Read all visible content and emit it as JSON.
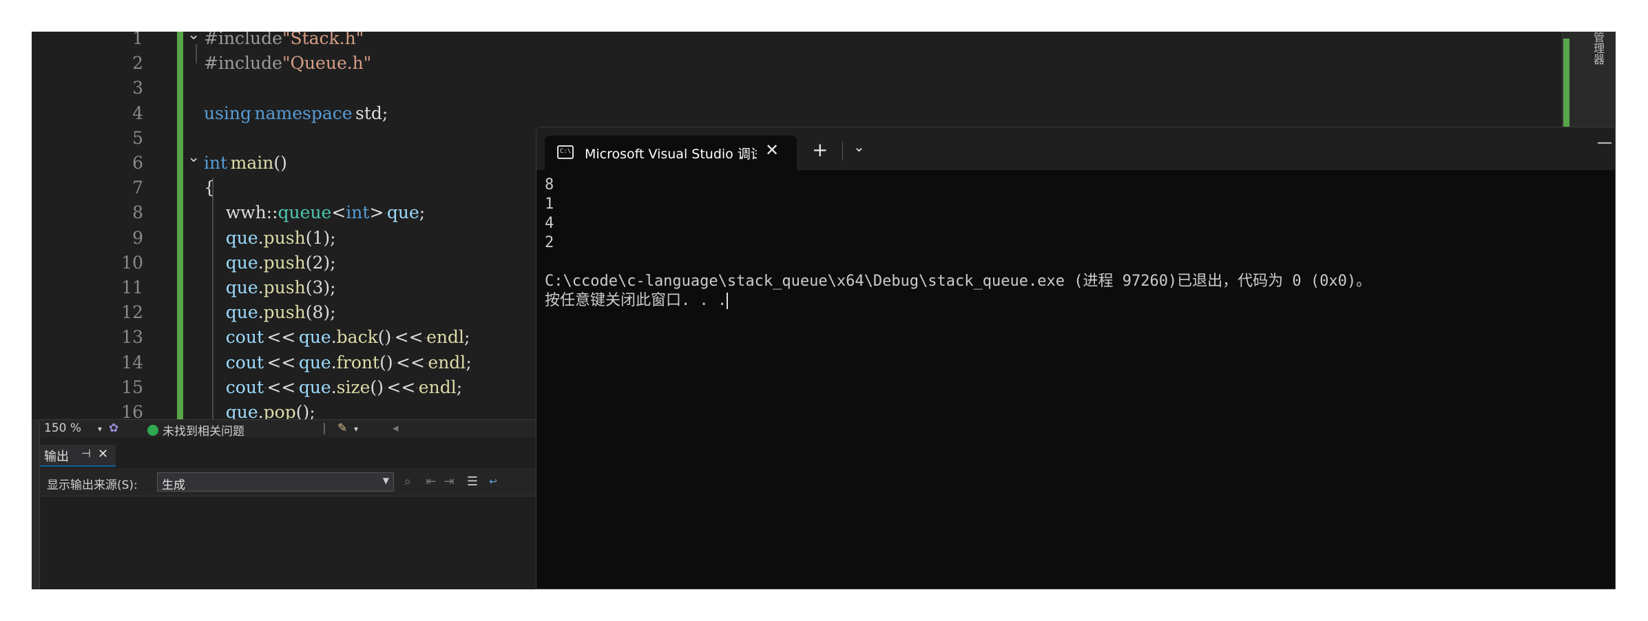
{
  "editor": {
    "line_numbers": [
      "1",
      "2",
      "3",
      "4",
      "5",
      "6",
      "7",
      "8",
      "9",
      "10",
      "11",
      "12",
      "13",
      "14",
      "15",
      "16"
    ],
    "lines": [
      {
        "segments": [
          {
            "cls": "pp",
            "text": "#include"
          },
          {
            "cls": "s",
            "text": "\"Stack.h\""
          }
        ]
      },
      {
        "segments": [
          {
            "cls": "pp",
            "text": "#include"
          },
          {
            "cls": "s",
            "text": "\"Queue.h\""
          }
        ]
      },
      {
        "segments": []
      },
      {
        "segments": [
          {
            "cls": "k",
            "text": "using"
          },
          {
            "cls": "d",
            "text": "·"
          },
          {
            "cls": "k",
            "text": "namespace"
          },
          {
            "cls": "d",
            "text": "·"
          },
          {
            "cls": "",
            "text": "std;"
          }
        ]
      },
      {
        "segments": []
      },
      {
        "segments": [
          {
            "cls": "k",
            "text": "int"
          },
          {
            "cls": "d",
            "text": "·"
          },
          {
            "cls": "f",
            "text": "main"
          },
          {
            "cls": "",
            "text": "()"
          }
        ]
      },
      {
        "segments": [
          {
            "cls": "",
            "text": "{"
          }
        ]
      },
      {
        "segments": [
          {
            "cls": "",
            "text": "    wwh::"
          },
          {
            "cls": "t",
            "text": "queue"
          },
          {
            "cls": "",
            "text": "<"
          },
          {
            "cls": "k",
            "text": "int"
          },
          {
            "cls": "",
            "text": ">"
          },
          {
            "cls": "d",
            "text": "·"
          },
          {
            "cls": "v",
            "text": "que"
          },
          {
            "cls": "",
            "text": ";"
          }
        ]
      },
      {
        "segments": [
          {
            "cls": "v",
            "text": "    que"
          },
          {
            "cls": "",
            "text": "."
          },
          {
            "cls": "f",
            "text": "push"
          },
          {
            "cls": "",
            "text": "(1);"
          }
        ]
      },
      {
        "segments": [
          {
            "cls": "v",
            "text": "    que"
          },
          {
            "cls": "",
            "text": "."
          },
          {
            "cls": "f",
            "text": "push"
          },
          {
            "cls": "",
            "text": "(2);"
          }
        ]
      },
      {
        "segments": [
          {
            "cls": "v",
            "text": "    que"
          },
          {
            "cls": "",
            "text": "."
          },
          {
            "cls": "f",
            "text": "push"
          },
          {
            "cls": "",
            "text": "(3);"
          }
        ]
      },
      {
        "segments": [
          {
            "cls": "v",
            "text": "    que"
          },
          {
            "cls": "",
            "text": "."
          },
          {
            "cls": "f",
            "text": "push"
          },
          {
            "cls": "",
            "text": "(8);"
          }
        ]
      },
      {
        "segments": [
          {
            "cls": "v",
            "text": "    cout"
          },
          {
            "cls": "d",
            "text": "·"
          },
          {
            "cls": "",
            "text": "<<"
          },
          {
            "cls": "d",
            "text": "·"
          },
          {
            "cls": "v",
            "text": "que"
          },
          {
            "cls": "",
            "text": "."
          },
          {
            "cls": "f",
            "text": "back"
          },
          {
            "cls": "",
            "text": "()"
          },
          {
            "cls": "d",
            "text": "·"
          },
          {
            "cls": "",
            "text": "<<"
          },
          {
            "cls": "d",
            "text": "·"
          },
          {
            "cls": "f",
            "text": "endl"
          },
          {
            "cls": "",
            "text": ";"
          }
        ]
      },
      {
        "segments": [
          {
            "cls": "v",
            "text": "    cout"
          },
          {
            "cls": "d",
            "text": "·"
          },
          {
            "cls": "",
            "text": "<<"
          },
          {
            "cls": "d",
            "text": "·"
          },
          {
            "cls": "v",
            "text": "que"
          },
          {
            "cls": "",
            "text": "."
          },
          {
            "cls": "f",
            "text": "front"
          },
          {
            "cls": "",
            "text": "()"
          },
          {
            "cls": "d",
            "text": "·"
          },
          {
            "cls": "",
            "text": "<<"
          },
          {
            "cls": "d",
            "text": "·"
          },
          {
            "cls": "f",
            "text": "endl"
          },
          {
            "cls": "",
            "text": ";"
          }
        ]
      },
      {
        "segments": [
          {
            "cls": "v",
            "text": "    cout"
          },
          {
            "cls": "d",
            "text": "·"
          },
          {
            "cls": "",
            "text": "<<"
          },
          {
            "cls": "d",
            "text": "·"
          },
          {
            "cls": "v",
            "text": "que"
          },
          {
            "cls": "",
            "text": "."
          },
          {
            "cls": "f",
            "text": "size"
          },
          {
            "cls": "",
            "text": "()"
          },
          {
            "cls": "d",
            "text": "·"
          },
          {
            "cls": "",
            "text": "<<"
          },
          {
            "cls": "d",
            "text": "·"
          },
          {
            "cls": "f",
            "text": "endl"
          },
          {
            "cls": "",
            "text": ";"
          }
        ]
      },
      {
        "segments": [
          {
            "cls": "v",
            "text": "    que"
          },
          {
            "cls": "",
            "text": "."
          },
          {
            "cls": "f",
            "text": "pop"
          },
          {
            "cls": "",
            "text": "();"
          }
        ]
      }
    ],
    "right_rail_label": "管理器"
  },
  "status_bar": {
    "zoom": "150 %",
    "issues": "未找到相关问题"
  },
  "output_panel": {
    "tab_label": "输出",
    "pin_glyph": "⊣",
    "close_glyph": "✕",
    "source_label": "显示输出来源(S):",
    "source_value": "生成"
  },
  "terminal": {
    "tab_title": "Microsoft Visual Studio 调试控制台",
    "icon_text": "C:\\",
    "new_tab": "+",
    "dropdown": "⌄",
    "minimize": "—",
    "close": "✕",
    "output_lines": [
      "8",
      "1",
      "4",
      "2",
      "",
      "C:\\ccode\\c-language\\stack_queue\\x64\\Debug\\stack_queue.exe (进程 97260)已退出，代码为 0 (0x0)。",
      "按任意键关闭此窗口. . ."
    ]
  },
  "colors": {
    "editor_bg": "#1f1f1f",
    "terminal_bg": "#0c0c0c",
    "change_bar": "#57a64a",
    "keyword": "#569cd6",
    "string": "#d69d85",
    "function": "#dcdcaa",
    "type": "#4ec9b0"
  }
}
